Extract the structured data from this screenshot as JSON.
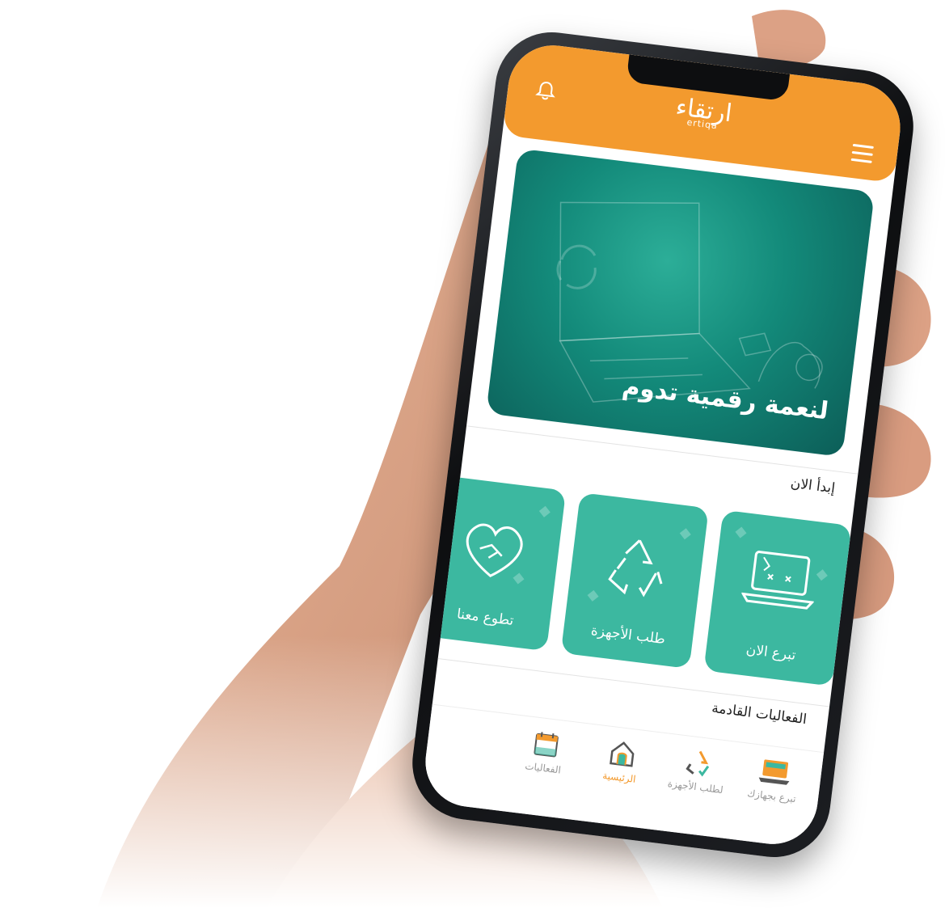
{
  "header": {
    "logo_ar": "ارتقاء",
    "logo_en": "ertiqa"
  },
  "banner": {
    "tagline": "لنعمة رقمية تدوم"
  },
  "start_section": {
    "title": "إبدأ الان"
  },
  "tiles": [
    {
      "label": "تبرع الان",
      "icon": "laptop-icon"
    },
    {
      "label": "طلب الأجهزة",
      "icon": "recycle-icon"
    },
    {
      "label": "تطوع معنا",
      "icon": "handshake-heart-icon"
    }
  ],
  "events_section": {
    "title": "الفعاليات القادمة"
  },
  "bottom_nav": [
    {
      "label": "تبرع بجهازك",
      "icon": "laptop-donate-icon"
    },
    {
      "label": "لطلب الأجهزة",
      "icon": "recycle-icon"
    },
    {
      "label": "الرئيسية",
      "icon": "home-icon",
      "active": true
    },
    {
      "label": "الفعاليات",
      "icon": "calendar-icon"
    }
  ],
  "colors": {
    "header": "#f39a2e",
    "tile": "#3cb8a0",
    "banner": "#138a7a",
    "active_nav": "#f39a2e"
  }
}
